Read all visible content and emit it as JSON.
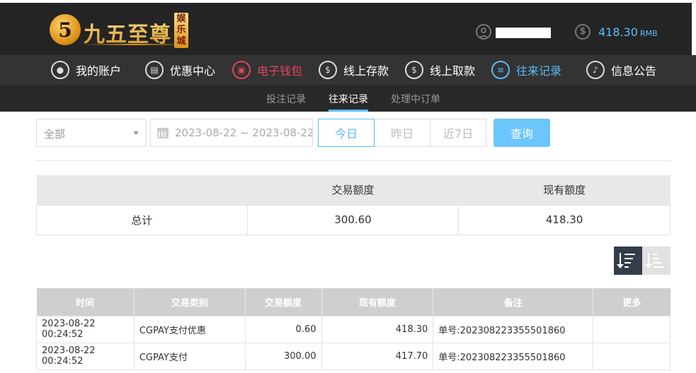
{
  "brand": {
    "logo_mark": "5",
    "name": "九五至尊",
    "sub": "娱乐城"
  },
  "account": {
    "balance": "418.30",
    "currency": "RMB"
  },
  "nav": {
    "items": [
      {
        "label": "我的账户",
        "icon": "user-icon"
      },
      {
        "label": "优惠中心",
        "icon": "gift-icon"
      },
      {
        "label": "电子钱包",
        "icon": "wallet-icon"
      },
      {
        "label": "线上存款",
        "icon": "deposit-icon"
      },
      {
        "label": "线上取款",
        "icon": "withdraw-icon"
      },
      {
        "label": "往来记录",
        "icon": "records-icon"
      },
      {
        "label": "信息公告",
        "icon": "bell-icon"
      }
    ]
  },
  "subnav": {
    "items": [
      "投注记录",
      "往来记录",
      "处理中订单"
    ],
    "active": "往来记录"
  },
  "filters": {
    "type_selected": "全部",
    "date_range": "2023-08-22 ~ 2023-08-22",
    "quick": [
      "今日",
      "昨日",
      "近7日"
    ],
    "quick_active": "今日",
    "search_label": "查询"
  },
  "summary": {
    "headers": [
      "",
      "交易额度",
      "现有额度"
    ],
    "row": [
      "总计",
      "300.60",
      "418.30"
    ]
  },
  "records": {
    "headers": [
      "时间",
      "交易类别",
      "交易额度",
      "现有额度",
      "备注",
      "更多"
    ],
    "rows": [
      [
        "2023-08-22 00:24:52",
        "CGPAY支付优惠",
        "0.60",
        "418.30",
        "单号:202308223355501860",
        ""
      ],
      [
        "2023-08-22 00:24:52",
        "CGPAY支付",
        "300.00",
        "417.70",
        "单号:202308223355501860",
        ""
      ]
    ]
  },
  "colors": {
    "accent": "#5bbcf7",
    "active_red": "#e4445e",
    "topbar": "#242424"
  }
}
